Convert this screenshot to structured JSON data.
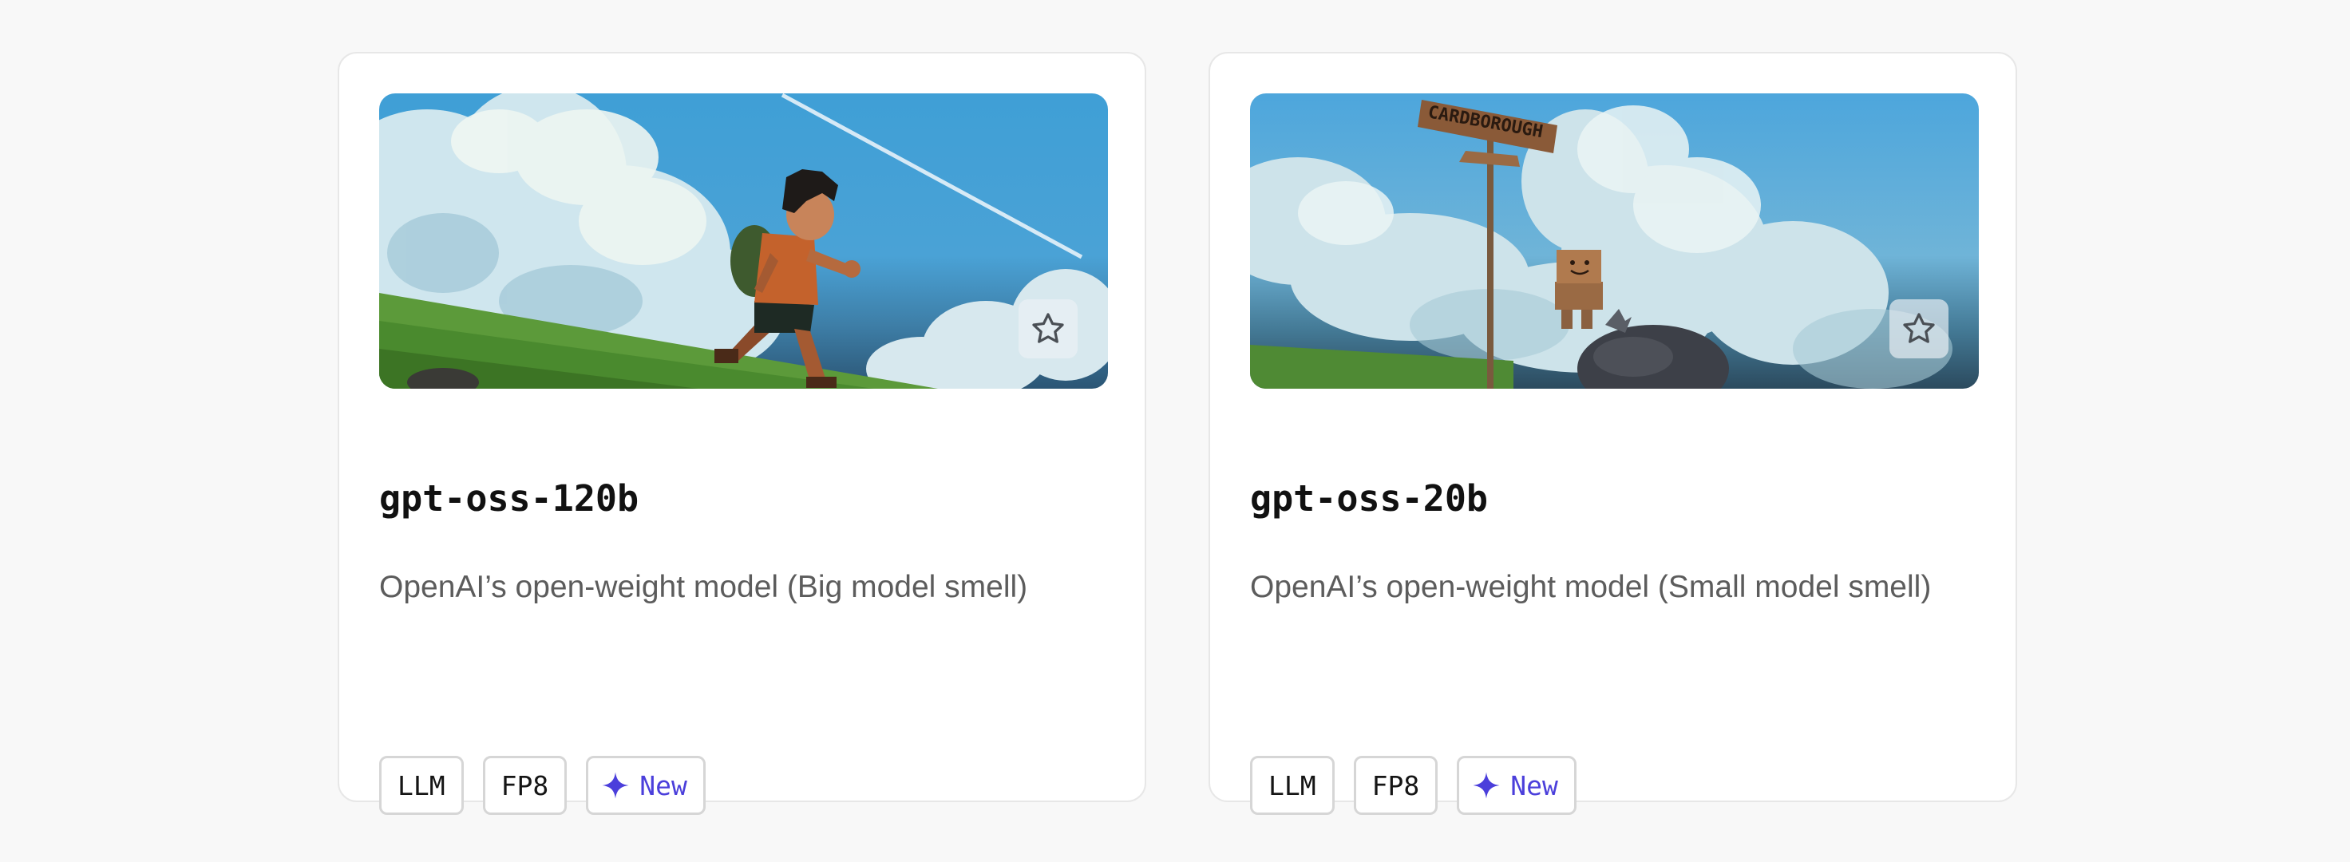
{
  "colors": {
    "page_background": "#f8f8f8",
    "card_background": "#ffffff",
    "card_border": "#e7e7e7",
    "title_text": "#111111",
    "description_text": "#5c5c5c",
    "tag_border": "#d6d6d6",
    "accent": "#4b3fdb"
  },
  "cards": [
    {
      "title": "gpt-oss-120b",
      "description": "OpenAI’s open-weight model (Big model smell)",
      "image_subject": "pixel-art boy running up a grassy hill under a blue sky with clouds",
      "favorite_icon": "star-outline-icon",
      "tags": [
        {
          "label": "LLM"
        },
        {
          "label": "FP8"
        },
        {
          "label": "New",
          "icon": "sparkle-icon"
        }
      ]
    },
    {
      "title": "gpt-oss-20b",
      "description": "OpenAI’s open-weight model (Small model smell)",
      "image_subject": "pixel-art cardboard box robot sitting on a rock next to a signpost under a blue sky",
      "sign_text": "CARDBOROUGH",
      "favorite_icon": "star-outline-icon",
      "tags": [
        {
          "label": "LLM"
        },
        {
          "label": "FP8"
        },
        {
          "label": "New",
          "icon": "sparkle-icon"
        }
      ]
    }
  ]
}
